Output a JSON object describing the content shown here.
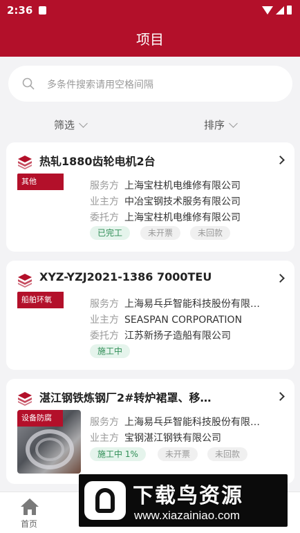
{
  "status_bar": {
    "time": "2:36"
  },
  "header": {
    "title": "项目"
  },
  "search": {
    "placeholder": "多条件搜索请用空格间隔"
  },
  "filters": {
    "filter_label": "筛选",
    "sort_label": "排序"
  },
  "projects": [
    {
      "title": "热轧1880齿轮电机2台",
      "category": "其他",
      "fields": [
        {
          "label": "服务方",
          "value": "上海宝柱机电维修有限公司"
        },
        {
          "label": "业主方",
          "value": "中冶宝钢技术服务有限公司"
        },
        {
          "label": "委托方",
          "value": "上海宝柱机电维修有限公司"
        }
      ],
      "statuses": [
        "已完工",
        "未开票",
        "未回款"
      ]
    },
    {
      "title": "XYZ-YZJ2021-1386 7000TEU",
      "category": "船舶环氧",
      "fields": [
        {
          "label": "服务方",
          "value": "上海易乓乒智能科技股份有限…"
        },
        {
          "label": "业主方",
          "value": "SEASPAN CORPORATION"
        },
        {
          "label": "委托方",
          "value": "江苏新扬子造船有限公司"
        }
      ],
      "statuses": [
        "施工中"
      ]
    },
    {
      "title": "湛江钢铁炼钢厂2#转炉裙罩、移…",
      "category": "设备防腐",
      "fields": [
        {
          "label": "服务方",
          "value": "上海易乓乒智能科技股份有限…"
        },
        {
          "label": "业主方",
          "value": "宝钢湛江钢铁有限公司"
        }
      ],
      "statuses": [
        "施工中 1%",
        "未开票",
        "未回款"
      ]
    }
  ],
  "tab_bar": {
    "home_label": "首页"
  },
  "watermark": {
    "title": "下载鸟资源",
    "url": "www.xiazainiao.com"
  },
  "colors": {
    "brand": "#b3102a",
    "status_green": "#2e8d55",
    "status_grey": "#999999"
  }
}
